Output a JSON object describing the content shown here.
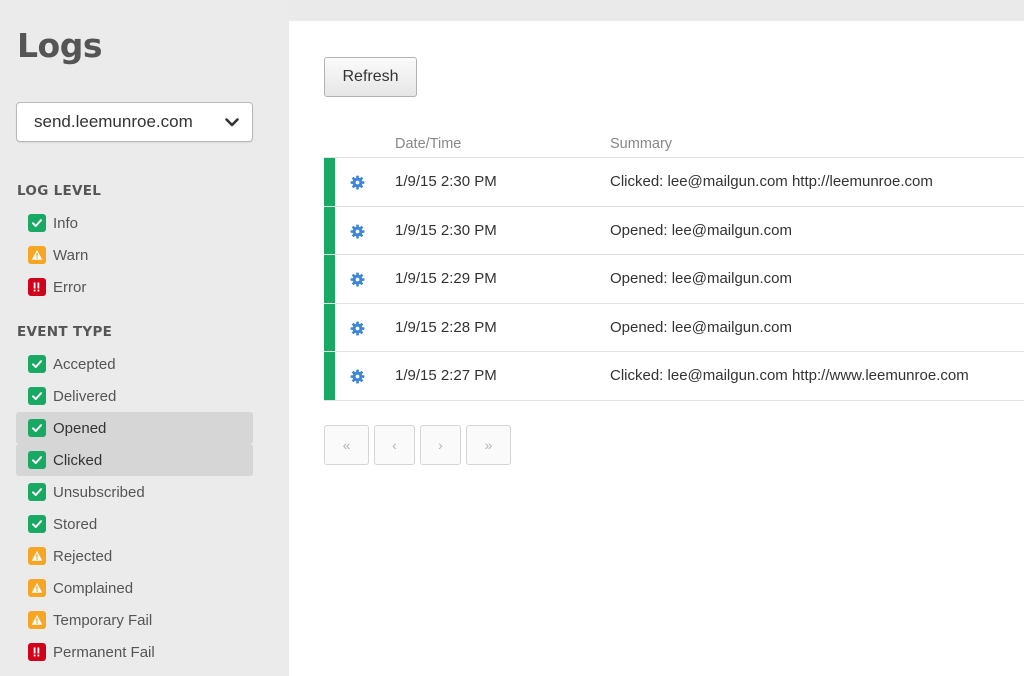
{
  "page_title": "Logs",
  "domain_select": {
    "value": "send.leemunroe.com"
  },
  "log_level": {
    "heading": "LOG LEVEL",
    "items": [
      {
        "label": "Info",
        "status": "success",
        "active": false
      },
      {
        "label": "Warn",
        "status": "warning",
        "active": false
      },
      {
        "label": "Error",
        "status": "error",
        "active": false
      }
    ]
  },
  "event_type": {
    "heading": "EVENT TYPE",
    "items": [
      {
        "label": "Accepted",
        "status": "success",
        "active": false
      },
      {
        "label": "Delivered",
        "status": "success",
        "active": false
      },
      {
        "label": "Opened",
        "status": "success",
        "active": true
      },
      {
        "label": "Clicked",
        "status": "success",
        "active": true
      },
      {
        "label": "Unsubscribed",
        "status": "success",
        "active": false
      },
      {
        "label": "Stored",
        "status": "success",
        "active": false
      },
      {
        "label": "Rejected",
        "status": "warning",
        "active": false
      },
      {
        "label": "Complained",
        "status": "warning",
        "active": false
      },
      {
        "label": "Temporary Fail",
        "status": "warning",
        "active": false
      },
      {
        "label": "Permanent Fail",
        "status": "error",
        "active": false
      }
    ]
  },
  "toolbar": {
    "refresh_label": "Refresh"
  },
  "table": {
    "columns": {
      "date": "Date/Time",
      "summary": "Summary"
    },
    "rows": [
      {
        "date": "1/9/15 2:30 PM",
        "summary": "Clicked: lee@mailgun.com http://leemunroe.com",
        "status": "success"
      },
      {
        "date": "1/9/15 2:30 PM",
        "summary": "Opened: lee@mailgun.com",
        "status": "success"
      },
      {
        "date": "1/9/15 2:29 PM",
        "summary": "Opened: lee@mailgun.com",
        "status": "success"
      },
      {
        "date": "1/9/15 2:28 PM",
        "summary": "Opened: lee@mailgun.com",
        "status": "success"
      },
      {
        "date": "1/9/15 2:27 PM",
        "summary": "Clicked: lee@mailgun.com http://www.leemunroe.com",
        "status": "success"
      }
    ]
  },
  "pagination": {
    "first": "«",
    "prev": "‹",
    "next": "›",
    "last": "»"
  },
  "colors": {
    "success": "#1aa865",
    "warning": "#f6a623",
    "error": "#d0021b",
    "gear": "#3b86d6"
  },
  "icons": {
    "success": "check-icon",
    "warning": "warning-icon",
    "error": "error-icon",
    "row_action": "gear-icon",
    "select": "chevron-down-icon"
  }
}
